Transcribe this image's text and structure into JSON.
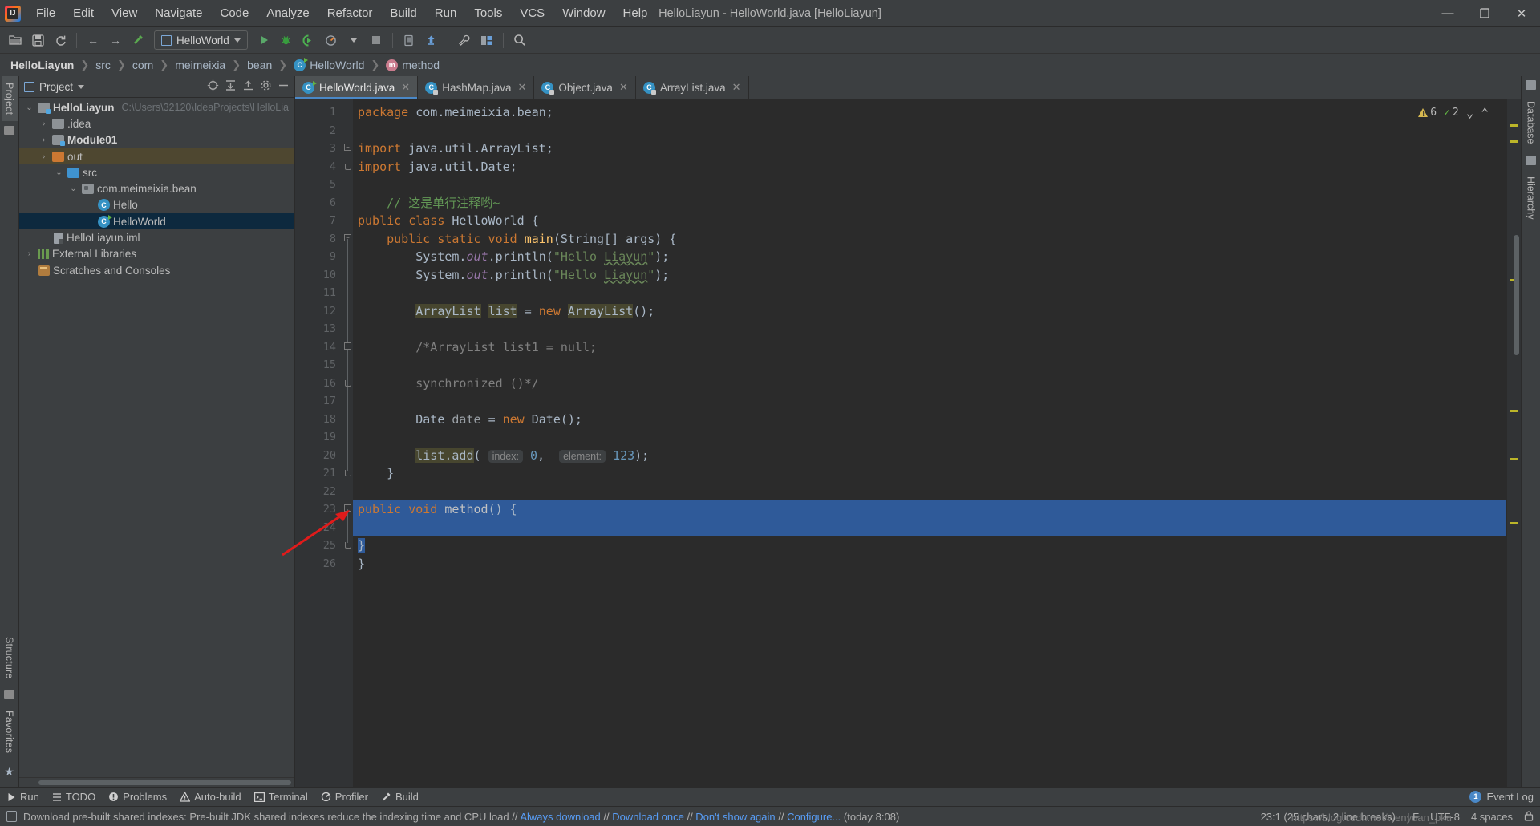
{
  "window": {
    "title": "HelloLiayun - HelloWorld.java [HelloLiayun]",
    "minimize": "—",
    "maximize": "❐",
    "close": "✕"
  },
  "menu": [
    "File",
    "Edit",
    "View",
    "Navigate",
    "Code",
    "Analyze",
    "Refactor",
    "Build",
    "Run",
    "Tools",
    "VCS",
    "Window",
    "Help"
  ],
  "toolbar": {
    "open_label": "open-folder",
    "save_label": "save-all",
    "sync_label": "sync",
    "back_label": "←",
    "forward_label": "→",
    "build_label": "build-hammer",
    "run_config": "HelloWorld",
    "run_label": "▶",
    "debug_label": "debug",
    "run_coverage_label": "run-with-coverage",
    "profile_label": "profiler",
    "stop_label": "■",
    "device_label": "device-manager",
    "update_label": "update-project",
    "settings_label": "settings-wrench",
    "structure_label": "project-structure",
    "search_label": "search-everywhere"
  },
  "breadcrumb": [
    "HelloLiayun",
    "src",
    "com",
    "meimeixia",
    "bean",
    "HelloWorld",
    "method"
  ],
  "left_rail": {
    "project_tab": "Project",
    "structure_tab": "Structure",
    "favorites_tab": "Favorites"
  },
  "right_rail": {
    "database_tab": "Database",
    "hierarchy_tab": "Hierarchy"
  },
  "project_panel": {
    "title": "Project",
    "tree": [
      {
        "indent": 0,
        "twisty": "⌄",
        "icon": "module-folder",
        "label": "HelloLiayun",
        "bold": true,
        "path": "C:\\Users\\32120\\IdeaProjects\\HelloLia",
        "state": "normal"
      },
      {
        "indent": 1,
        "twisty": "›",
        "icon": "folder-grey",
        "label": ".idea",
        "bold": false,
        "path": "",
        "state": "normal"
      },
      {
        "indent": 1,
        "twisty": "›",
        "icon": "module-folder",
        "label": "Module01",
        "bold": true,
        "path": "",
        "state": "normal"
      },
      {
        "indent": 1,
        "twisty": "›",
        "icon": "folder-orange",
        "label": "out",
        "bold": false,
        "path": "",
        "state": "highlight"
      },
      {
        "indent": 1,
        "twisty": "⌄",
        "icon": "folder-blue",
        "label": "src",
        "bold": false,
        "path": "",
        "state": "normal"
      },
      {
        "indent": 2,
        "twisty": "⌄",
        "icon": "package",
        "label": "com.meimeixia.bean",
        "bold": false,
        "path": "",
        "state": "normal"
      },
      {
        "indent": 3,
        "twisty": "",
        "icon": "class",
        "label": "Hello",
        "bold": false,
        "path": "",
        "state": "normal"
      },
      {
        "indent": 3,
        "twisty": "",
        "icon": "class-runnable",
        "label": "HelloWorld",
        "bold": false,
        "path": "",
        "state": "selected"
      },
      {
        "indent": 1,
        "twisty": "",
        "icon": "iml",
        "label": "HelloLiayun.iml",
        "bold": false,
        "path": "",
        "state": "normal"
      },
      {
        "indent": 0,
        "twisty": "›",
        "icon": "library",
        "label": "External Libraries",
        "bold": false,
        "path": "",
        "state": "normal"
      },
      {
        "indent": 0,
        "twisty": "",
        "icon": "scratch",
        "label": "Scratches and Consoles",
        "bold": false,
        "path": "",
        "state": "normal"
      }
    ]
  },
  "editor": {
    "tabs": [
      {
        "label": "HelloWorld.java",
        "icon": "class-runnable",
        "active": true,
        "close": "✕"
      },
      {
        "label": "HashMap.java",
        "icon": "class-locked",
        "active": false,
        "close": "✕"
      },
      {
        "label": "Object.java",
        "icon": "class-locked",
        "active": false,
        "close": "✕"
      },
      {
        "label": "ArrayList.java",
        "icon": "class-locked",
        "active": false,
        "close": "✕"
      }
    ],
    "inspections": {
      "warning_count": "6",
      "ok_count": "2",
      "chevron_down": "⌄",
      "chevron_up": "⌃"
    },
    "lines": [
      {
        "n": "1",
        "runmark": false,
        "fold": "none"
      },
      {
        "n": "2",
        "runmark": false,
        "fold": "none"
      },
      {
        "n": "3",
        "runmark": false,
        "fold": "import-top"
      },
      {
        "n": "4",
        "runmark": false,
        "fold": "import-bot"
      },
      {
        "n": "5",
        "runmark": false,
        "fold": "none"
      },
      {
        "n": "6",
        "runmark": false,
        "fold": "none"
      },
      {
        "n": "7",
        "runmark": true,
        "fold": "none"
      },
      {
        "n": "8",
        "runmark": true,
        "fold": "open"
      },
      {
        "n": "9",
        "runmark": false,
        "fold": "bar"
      },
      {
        "n": "10",
        "runmark": false,
        "fold": "bar"
      },
      {
        "n": "11",
        "runmark": false,
        "fold": "bar"
      },
      {
        "n": "12",
        "runmark": false,
        "fold": "bar"
      },
      {
        "n": "13",
        "runmark": false,
        "fold": "bar"
      },
      {
        "n": "14",
        "runmark": false,
        "fold": "open2"
      },
      {
        "n": "15",
        "runmark": false,
        "fold": "bar"
      },
      {
        "n": "16",
        "runmark": false,
        "fold": "close2"
      },
      {
        "n": "17",
        "runmark": false,
        "fold": "bar"
      },
      {
        "n": "18",
        "runmark": false,
        "fold": "bar"
      },
      {
        "n": "19",
        "runmark": false,
        "fold": "bar"
      },
      {
        "n": "20",
        "runmark": false,
        "fold": "bar"
      },
      {
        "n": "21",
        "runmark": false,
        "fold": "close"
      },
      {
        "n": "22",
        "runmark": false,
        "fold": "bulb"
      },
      {
        "n": "23",
        "runmark": false,
        "fold": "open3"
      },
      {
        "n": "24",
        "runmark": false,
        "fold": "bar"
      },
      {
        "n": "25",
        "runmark": false,
        "fold": "close3"
      },
      {
        "n": "26",
        "runmark": false,
        "fold": "none"
      }
    ],
    "code": {
      "l1_kw": "package",
      "l1_rest": " com.meimeixia.bean;",
      "l3_kw": "import",
      "l3_rest": " java.util.ArrayList;",
      "l4_kw": "import",
      "l4_rest": " java.util.Date;",
      "l6_comment": "// 这是单行注释哟~",
      "l7_a": "public class ",
      "l7_b": "HelloWorld",
      "l7_c": " {",
      "l8_a": "public static void ",
      "l8_b": "main",
      "l8_c": "(String[] args) {",
      "l9_sys": "System.",
      "l9_out": "out",
      "l9_pr": ".println(",
      "l9_str_a": "\"Hello ",
      "l9_str_b": "Liayun",
      "l9_str_c": "\"",
      "l9_end": ");",
      "l10_sys": "System.",
      "l10_out": "out",
      "l10_pr": ".println(",
      "l10_str_a": "\"Hello ",
      "l10_str_b": "Liayun",
      "l10_str_c": "\"",
      "l10_end": ");",
      "l12_t1": "ArrayList",
      "l12_t2": "list",
      "l12_eq": " = ",
      "l12_new": "new",
      "l12_t3": "ArrayList",
      "l12_end": "();",
      "l14_cmt": "/*ArrayList list1 = null;",
      "l16_cmt": "synchronized ()*/",
      "l18_type": "Date",
      "l18_var": " date ",
      "l18_eq": "= ",
      "l18_new": "new ",
      "l18_ctor": "Date();",
      "l20_call": "list.add",
      "l20_paren": "(",
      "l20_hint1": "index:",
      "l20_v1": "0",
      "l20_comma": ",",
      "l20_hint2": "element:",
      "l20_v2": "123",
      "l20_end": ");",
      "l21_brace": "}",
      "l23_kw": "public void ",
      "l23_mth": "method",
      "l23_rest": "() {",
      "l25_brace": "}",
      "l26_brace": "}"
    }
  },
  "bottom_tools": [
    {
      "label": "Run",
      "icon": "run-icon"
    },
    {
      "label": "TODO",
      "icon": "todo-icon"
    },
    {
      "label": "Problems",
      "icon": "problems-icon"
    },
    {
      "label": "Auto-build",
      "icon": "warning-icon"
    },
    {
      "label": "Terminal",
      "icon": "terminal-icon"
    },
    {
      "label": "Profiler",
      "icon": "profiler-icon"
    },
    {
      "label": "Build",
      "icon": "build-icon"
    }
  ],
  "event_log": {
    "label": "Event Log",
    "count": "1"
  },
  "status": {
    "message_prefix": "Download pre-built shared indexes:",
    "message_body": " Pre-built JDK shared indexes reduce the indexing time and CPU load //",
    "link_always": " Always download",
    "sep1": " //",
    "link_once": " Download once",
    "sep2": " //",
    "link_dont": " Don't show again",
    "sep3": " //",
    "link_configure": " Configure...",
    "time": " (today 8:08)",
    "caret": "23:1 (25 chars, 2 line breaks)",
    "line_sep": "LF",
    "encoding": "UTF-8",
    "indent": "4 spaces",
    "lock": "lock-icon",
    "watermark": "https://blog.csdn.net/wenyuan_pku"
  },
  "colors": {
    "accent_blue": "#4a88c7",
    "selection_blue": "#2f5a99",
    "keyword_orange": "#cc7832",
    "string_green": "#6a8759",
    "comment_green": "#629755",
    "number_blue": "#6897bb",
    "field_purple": "#9876aa",
    "method_yellow": "#ffc66d",
    "warning_yellow": "#bbb529",
    "arrow_red": "#e01b1b"
  }
}
